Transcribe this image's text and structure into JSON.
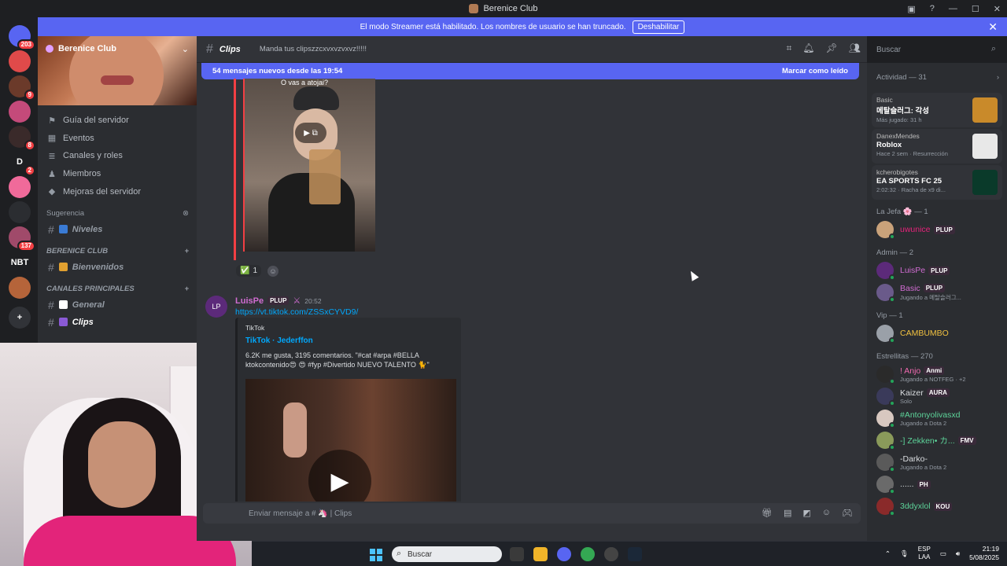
{
  "window": {
    "title": "Berenice Club"
  },
  "guilds": [
    {
      "label": "",
      "badge": "203",
      "color": "#5865f2"
    },
    {
      "label": "",
      "badge": "",
      "color": "#e04a4a"
    },
    {
      "label": "",
      "badge": "9",
      "color": "#6b3a2a"
    },
    {
      "label": "",
      "badge": "",
      "color": "#c44a7a"
    },
    {
      "label": "",
      "badge": "8",
      "color": "#3a2a2a"
    },
    {
      "label": "D",
      "badge": "2",
      "color": "#1e1f22"
    },
    {
      "label": "",
      "badge": "",
      "color": "#f06a9a"
    },
    {
      "label": "",
      "badge": "",
      "color": "#2b2d31"
    },
    {
      "label": "",
      "badge": "137",
      "color": "#a04a6a"
    },
    {
      "label": "NBT",
      "badge": "",
      "color": "#1e1f22"
    },
    {
      "label": "",
      "badge": "",
      "color": "#b5643a"
    }
  ],
  "banner": {
    "text": "El modo Streamer está habilitado. Los nombres de usuario se han truncado.",
    "button": "Deshabilitar"
  },
  "server": {
    "name": "Berenice Club",
    "nav": [
      {
        "icon": "flag-icon",
        "glyph": "⚑",
        "label": "Guía del servidor"
      },
      {
        "icon": "calendar-icon",
        "glyph": "▦",
        "label": "Eventos"
      },
      {
        "icon": "channels-icon",
        "glyph": "≣",
        "label": "Canales y roles"
      },
      {
        "icon": "members-icon",
        "glyph": "♟",
        "label": "Miembros"
      },
      {
        "icon": "boost-icon",
        "glyph": "◆",
        "label": "Mejoras del servidor"
      }
    ],
    "suggestion_label": "Sugerencia",
    "suggestion_channel": "Niveles",
    "categories": [
      {
        "name": "BERENICE CLUB",
        "channels": [
          "Bienvenidos"
        ]
      },
      {
        "name": "CANALES PRINCIPALES",
        "channels": [
          "General",
          "Clips"
        ]
      }
    ]
  },
  "header": {
    "channel": "Clips",
    "topic": "Manda tus clipszzcxvxvzvxvz!!!!!",
    "search_placeholder": "Buscar"
  },
  "chat": {
    "new_messages": "54 mensajes nuevos desde las 19:54",
    "mark_read": "Marcar como leído",
    "video_caption": "O vas a atojai?",
    "reaction_count": "1",
    "message": {
      "author": "LuisPe",
      "tag": "PLUP",
      "time": "20:52",
      "link": "https://vt.tiktok.com/ZSSxCYVD9/",
      "embed_provider": "TikTok",
      "embed_title": "TikTok · Jederffon",
      "embed_desc": "6.2K me gusta, 3195 comentarios. \"#cat #arpa #BELLA ktokcontenido😍 😍 #fyp #Divertido NUEVO TALENTO 🐈\""
    },
    "composer_placeholder": "Enviar mensaje a # 🦄 | Clips"
  },
  "members": {
    "activity_header": "Actividad — 31",
    "activities": [
      {
        "user": "Basic",
        "game": "메탈슬러그: 각성",
        "status": "Más jugado: 31 h",
        "color": "#c98a2a"
      },
      {
        "user": "DanexMendes",
        "game": "Roblox",
        "status": "Hace 2 sem · Resurrección",
        "color": "#e8e8e8"
      },
      {
        "user": "kcherobigotes",
        "game": "EA SPORTS FC 25",
        "status": "2:02:32 · Racha de x9 di...",
        "color": "#0a3a2a"
      }
    ],
    "groups": [
      {
        "name": "La Jefa 🌸 — 1",
        "members": [
          {
            "name": "uwunice",
            "tag": "PLUP",
            "sub": "",
            "color": "#e5227a",
            "av": "#c9a27a"
          }
        ]
      },
      {
        "name": "Admin — 2",
        "members": [
          {
            "name": "LuisPe",
            "tag": "PLUP",
            "sub": "",
            "color": "#d06cd1",
            "av": "#5c2a7a"
          },
          {
            "name": "Basic",
            "tag": "PLUP",
            "sub": "Jugando a 메탈슬러그...",
            "color": "#d06cd1",
            "av": "#6a5a8a"
          }
        ]
      },
      {
        "name": "Vip — 1",
        "members": [
          {
            "name": "CAMBUMBO",
            "tag": "",
            "sub": "",
            "color": "#f0c040",
            "av": "#9aa0a8"
          }
        ]
      },
      {
        "name": "Estrellitas — 270",
        "members": [
          {
            "name": "! Anjo",
            "tag": "Anmi",
            "sub": "Jugando a  NOTFEG · +2",
            "color": "#f06ab0",
            "av": "#2a2a2a"
          },
          {
            "name": "Kaizer",
            "tag": "AURA",
            "sub": "Solo",
            "color": "#dbdee1",
            "av": "#3a3a5a"
          },
          {
            "name": "#Antonyolivasxd",
            "tag": "",
            "sub": "Jugando a Dota 2",
            "color": "#5dd49a",
            "av": "#d8c8c0"
          },
          {
            "name": "-] Zekken• カ...",
            "tag": "FMV",
            "sub": "",
            "color": "#5dd49a",
            "av": "#8a9a5a"
          },
          {
            "name": "-Darko-",
            "tag": "",
            "sub": "Jugando a Dota 2",
            "color": "#dbdee1",
            "av": "#5a5a5a"
          },
          {
            "name": "......",
            "tag": "PH",
            "sub": "",
            "color": "#dbdee1",
            "av": "#6a6a6a"
          },
          {
            "name": "3ddyxlol",
            "tag": "KOU",
            "sub": "",
            "color": "#5dd49a",
            "av": "#8a2a2a"
          }
        ]
      }
    ]
  },
  "taskbar": {
    "search": "Buscar",
    "lang_top": "ESP",
    "lang_bottom": "LAA",
    "time": "21:19",
    "date": "5/08/2025"
  }
}
